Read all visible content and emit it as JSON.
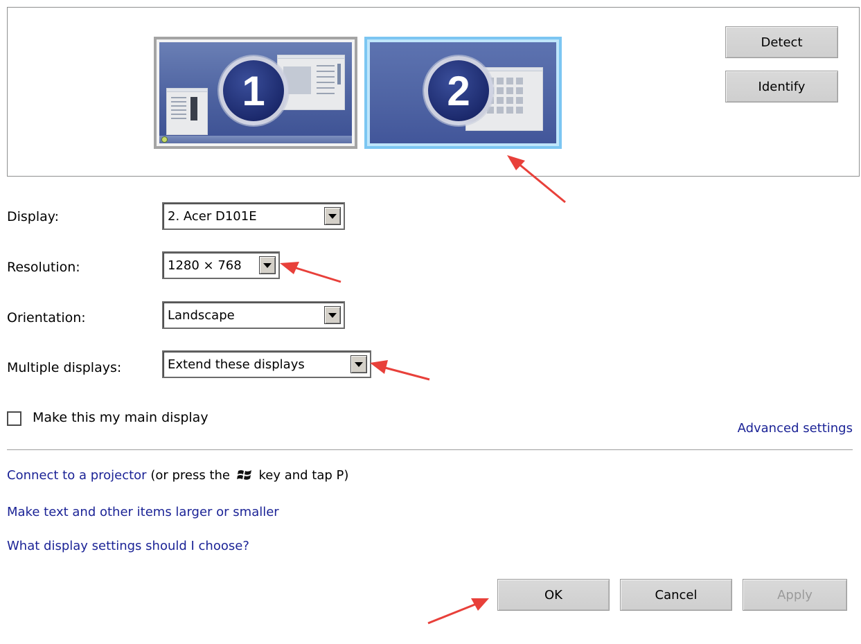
{
  "monitor_area": {
    "monitors": [
      {
        "number": "1",
        "selected": false
      },
      {
        "number": "2",
        "selected": true
      }
    ],
    "detect_label": "Detect",
    "identify_label": "Identify"
  },
  "settings": {
    "display": {
      "label": "Display:",
      "value": "2. Acer D101E"
    },
    "resolution": {
      "label": "Resolution:",
      "value": "1280 × 768"
    },
    "orientation": {
      "label": "Orientation:",
      "value": "Landscape"
    },
    "multiple_displays": {
      "label": "Multiple displays:",
      "value": "Extend these displays"
    }
  },
  "main_display_checkbox": {
    "label": "Make this my main display",
    "checked": false
  },
  "advanced_settings_link": "Advanced settings",
  "links": {
    "projector_link": "Connect to a projector",
    "projector_suffix_before": "(or press the",
    "projector_suffix_after": "key and tap P)",
    "text_size_link": "Make text and other items larger or smaller",
    "help_link": "What display settings should I choose?"
  },
  "footer": {
    "ok_label": "OK",
    "cancel_label": "Cancel",
    "apply_label": "Apply"
  },
  "colors": {
    "link": "#1b2396",
    "annotation_arrow": "#e8403a",
    "selected_monitor_border": "#7cc6f2"
  }
}
